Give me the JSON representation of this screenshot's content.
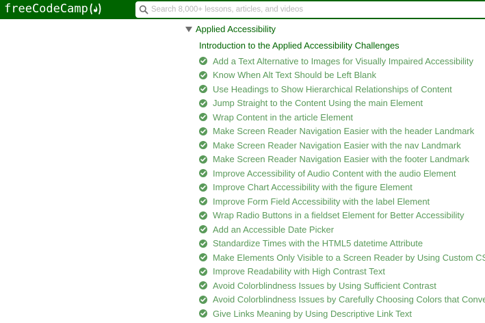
{
  "header": {
    "logo_text": "freeCodeCamp",
    "logo_icon": "flame-icon",
    "search_placeholder": "Search 8,000+ lessons, articles, and videos",
    "search_icon": "search-icon"
  },
  "colors": {
    "navbar": "#006400",
    "section_title": "#006400",
    "completed_text": "#5a9a5a",
    "check": "#5a9a5a"
  },
  "section": {
    "title": "Applied Accessibility",
    "expanded": true,
    "intro_link": "Introduction to the Applied Accessibility Challenges"
  },
  "challenges": [
    {
      "label": "Add a Text Alternative to Images for Visually Impaired Accessibility",
      "completed": true
    },
    {
      "label": "Know When Alt Text Should be Left Blank",
      "completed": true
    },
    {
      "label": "Use Headings to Show Hierarchical Relationships of Content",
      "completed": true
    },
    {
      "label": "Jump Straight to the Content Using the main Element",
      "completed": true
    },
    {
      "label": "Wrap Content in the article Element",
      "completed": true
    },
    {
      "label": "Make Screen Reader Navigation Easier with the header Landmark",
      "completed": true
    },
    {
      "label": "Make Screen Reader Navigation Easier with the nav Landmark",
      "completed": true
    },
    {
      "label": "Make Screen Reader Navigation Easier with the footer Landmark",
      "completed": true
    },
    {
      "label": "Improve Accessibility of Audio Content with the audio Element",
      "completed": true
    },
    {
      "label": "Improve Chart Accessibility with the figure Element",
      "completed": true
    },
    {
      "label": "Improve Form Field Accessibility with the label Element",
      "completed": true
    },
    {
      "label": "Wrap Radio Buttons in a fieldset Element for Better Accessibility",
      "completed": true
    },
    {
      "label": "Add an Accessible Date Picker",
      "completed": true
    },
    {
      "label": "Standardize Times with the HTML5 datetime Attribute",
      "completed": true
    },
    {
      "label": "Make Elements Only Visible to a Screen Reader by Using Custom CSS",
      "completed": true
    },
    {
      "label": "Improve Readability with High Contrast Text",
      "completed": true
    },
    {
      "label": "Avoid Colorblindness Issues by Using Sufficient Contrast",
      "completed": true
    },
    {
      "label": "Avoid Colorblindness Issues by Carefully Choosing Colors that Convey Info",
      "completed": true
    },
    {
      "label": "Give Links Meaning by Using Descriptive Link Text",
      "completed": true
    }
  ]
}
